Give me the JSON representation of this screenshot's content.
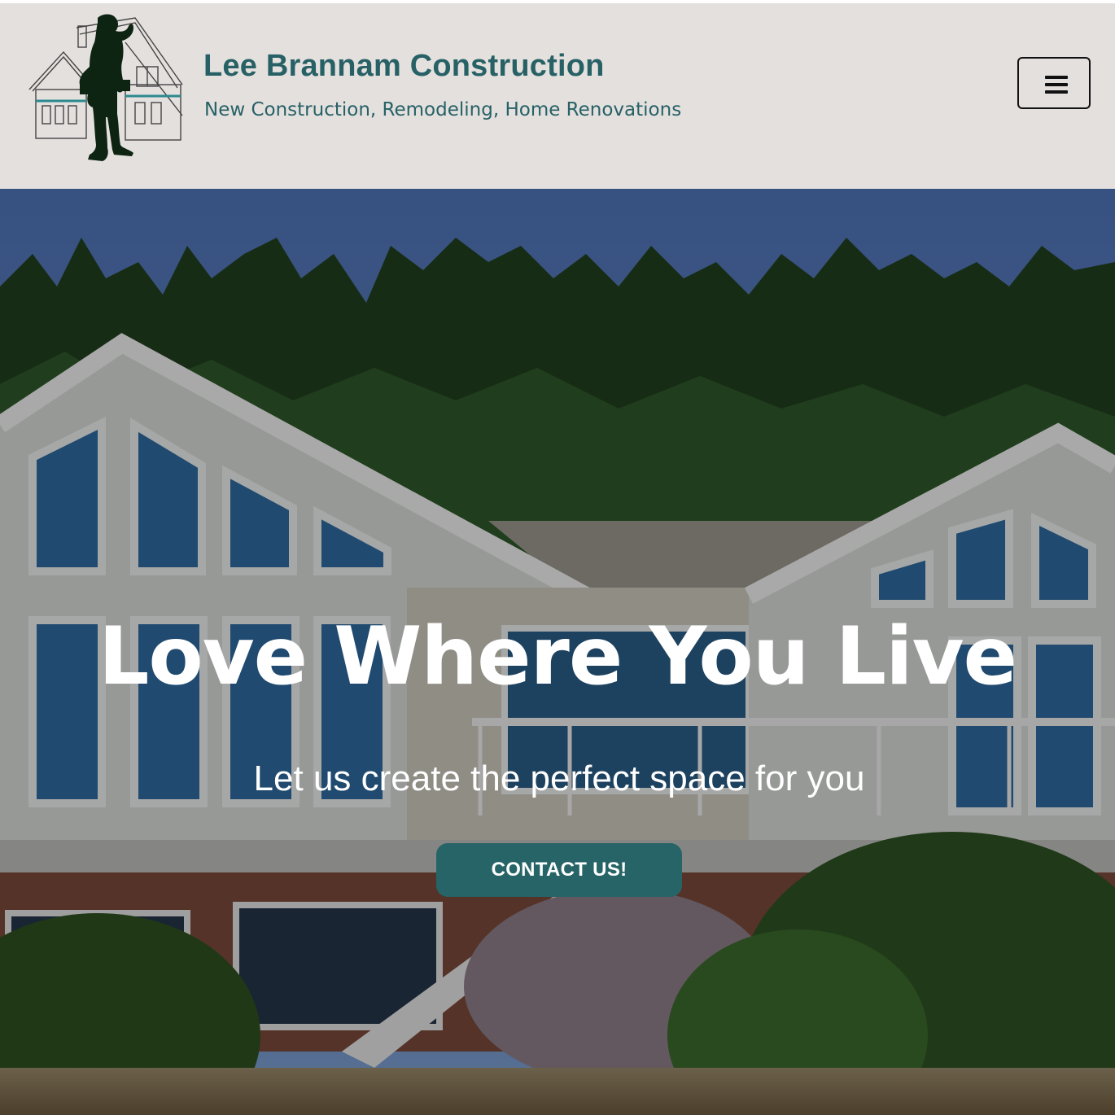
{
  "header": {
    "site_title": "Lee Brannam Construction",
    "tagline": "New Construction, Remodeling, Home Renovations",
    "logo_icon": "builder-house-logo",
    "menu_icon": "hamburger-menu-icon"
  },
  "hero": {
    "title": "Love Where You Live",
    "subtitle": "Let us create the perfect space for you",
    "cta_label": "CONTACT US!"
  },
  "colors": {
    "header_bg": "#e4e0de",
    "brand_teal": "#276166",
    "button_teal": "#266468",
    "text_white": "#ffffff"
  }
}
